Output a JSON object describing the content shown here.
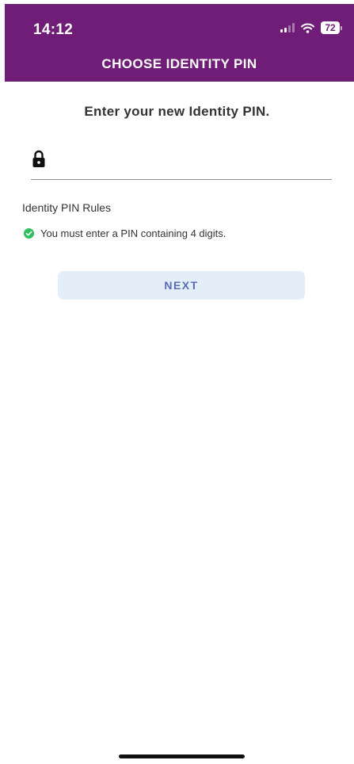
{
  "status_bar": {
    "time": "14:12",
    "battery_level": "72",
    "icons": [
      "cellular-signal-icon",
      "wifi-icon",
      "battery-icon"
    ]
  },
  "nav": {
    "title": "CHOOSE IDENTITY PIN"
  },
  "form": {
    "prompt": "Enter your new Identity PIN.",
    "pin_value": "",
    "lock_icon": "lock-icon"
  },
  "rules": {
    "heading": "Identity PIN Rules",
    "items": [
      {
        "text": "You must enter a PIN containing 4 digits.",
        "status_icon": "check-circle-icon",
        "satisfied": true
      }
    ]
  },
  "actions": {
    "next_label": "NEXT"
  },
  "colors": {
    "header_background": "#6f1d77",
    "button_background": "#e3eef9",
    "button_text": "#5a6db4",
    "check_green": "#2fbf5f"
  }
}
